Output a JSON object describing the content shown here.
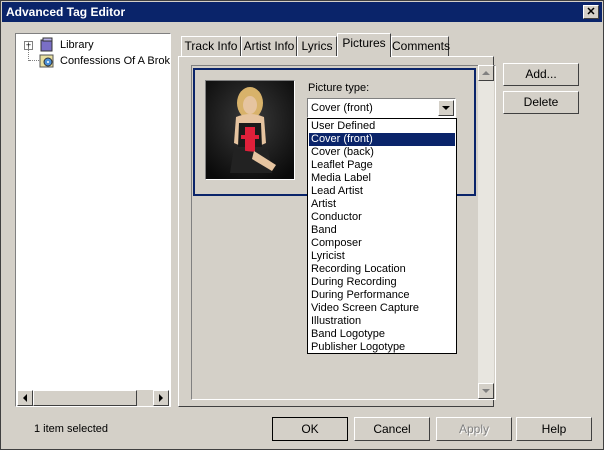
{
  "window": {
    "title": "Advanced Tag Editor",
    "close_glyph": "✕"
  },
  "tree": {
    "items": [
      {
        "label": "Library",
        "icon": "library-icon",
        "expander": "+"
      },
      {
        "label": "Confessions Of A Broke",
        "icon": "album-icon"
      }
    ]
  },
  "tabs": [
    {
      "label": "Track Info"
    },
    {
      "label": "Artist Info"
    },
    {
      "label": "Lyrics"
    },
    {
      "label": "Pictures",
      "active": true
    },
    {
      "label": "Comments"
    }
  ],
  "pictures": {
    "picture_type_label": "Picture type:",
    "selected_value": "Cover (front)",
    "options": [
      "User Defined",
      "Cover (front)",
      "Cover (back)",
      "Leaflet Page",
      "Media Label",
      "Lead Artist",
      "Artist",
      "Conductor",
      "Band",
      "Composer",
      "Lyricist",
      "Recording Location",
      "During Recording",
      "During Performance",
      "Video Screen Capture",
      "Illustration",
      "Band Logotype",
      "Publisher Logotype"
    ],
    "add_label": "Add...",
    "delete_label": "Delete"
  },
  "footer": {
    "status": "1 item selected",
    "ok_label": "OK",
    "cancel_label": "Cancel",
    "apply_label": "Apply",
    "help_label": "Help"
  },
  "colors": {
    "titlebar": "#0a246a",
    "face": "#d4d0c8",
    "selection": "#0a246a"
  }
}
